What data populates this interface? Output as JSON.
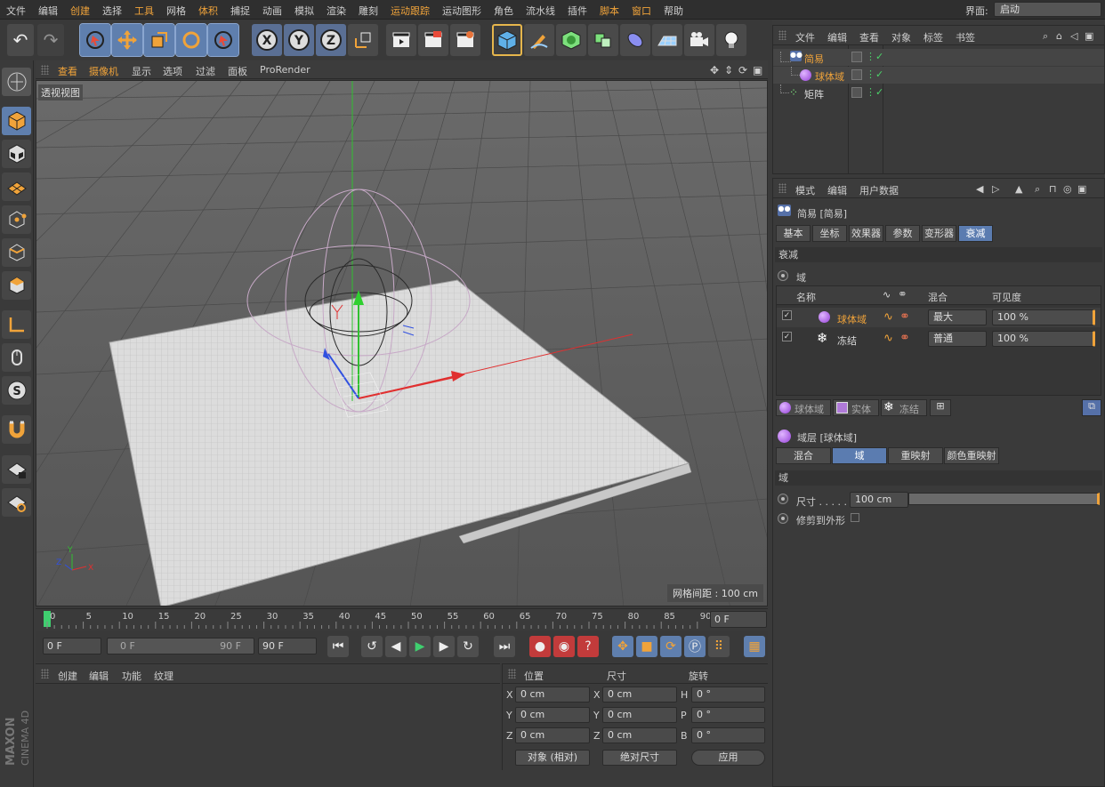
{
  "menubar": {
    "items": [
      "文件",
      "编辑",
      "创建",
      "选择",
      "工具",
      "网格",
      "体积",
      "捕捉",
      "动画",
      "模拟",
      "渲染",
      "雕刻",
      "运动跟踪",
      "运动图形",
      "角色",
      "流水线",
      "插件",
      "脚本",
      "窗口",
      "帮助"
    ],
    "highlighted": [
      "创建",
      "工具",
      "体积",
      "运动跟踪",
      "脚本",
      "窗口"
    ],
    "layout_label": "界面:",
    "layout_value": "启动"
  },
  "viewport": {
    "menus": [
      "查看",
      "摄像机",
      "显示",
      "选项",
      "过滤",
      "面板",
      "ProRender"
    ],
    "view_name": "透视视图",
    "grid_spacing": "网格间距 : 100 cm",
    "axis_labels": {
      "x": "X",
      "y": "Y",
      "z": "Z"
    }
  },
  "timeline": {
    "ticks": [
      "0",
      "5",
      "10",
      "15",
      "20",
      "25",
      "30",
      "35",
      "40",
      "45",
      "50",
      "55",
      "60",
      "65",
      "70",
      "75",
      "80",
      "85",
      "90"
    ],
    "current_frame_field": "0 F"
  },
  "transport": {
    "start": "0 F",
    "range_start": "0 F",
    "range_end": "90 F",
    "end": "90 F"
  },
  "material_panel": {
    "menus": [
      "创建",
      "编辑",
      "功能",
      "纹理"
    ]
  },
  "coord_panel": {
    "headers": [
      "位置",
      "尺寸",
      "旋转"
    ],
    "rows": [
      {
        "a": "X",
        "av": "0 cm",
        "b": "X",
        "bv": "0 cm",
        "c": "H",
        "cv": "0 °"
      },
      {
        "a": "Y",
        "av": "0 cm",
        "b": "Y",
        "bv": "0 cm",
        "c": "P",
        "cv": "0 °"
      },
      {
        "a": "Z",
        "av": "0 cm",
        "b": "Z",
        "bv": "0 cm",
        "c": "B",
        "cv": "0 °"
      }
    ],
    "mode_select": "对象 (相对)",
    "size_select": "绝对尺寸",
    "apply": "应用"
  },
  "object_manager": {
    "menus": [
      "文件",
      "编辑",
      "查看",
      "对象",
      "标签",
      "书签"
    ],
    "objects": [
      {
        "name": "简易",
        "indent": 0
      },
      {
        "name": "球体域",
        "indent": 1
      },
      {
        "name": "矩阵",
        "indent": 0
      }
    ]
  },
  "attributes": {
    "menus": [
      "模式",
      "编辑",
      "用户数据"
    ],
    "object_title": "简易 [简易]",
    "tabs": [
      "基本",
      "坐标",
      "效果器",
      "参数",
      "变形器",
      "衰减"
    ],
    "active_tab": "衰减",
    "section_falloff": "衰减",
    "field_radio_label": "域",
    "field_list_headers": {
      "name": "名称",
      "blend": "混合",
      "visibility": "可见度"
    },
    "field_list": [
      {
        "name": "球体域",
        "blend": "最大",
        "visibility": "100 %"
      },
      {
        "name": "冻结",
        "blend": "普通",
        "visibility": "100 %"
      }
    ],
    "add_buttons": [
      "球体域",
      "实体",
      "冻结"
    ],
    "layer_title": "域层 [球体域]",
    "layer_tabs": [
      "混合",
      "域",
      "重映射",
      "颜色重映射"
    ],
    "active_layer_tab": "域",
    "section_field": "域",
    "size_label": "尺寸 . . . . . .",
    "size_value": "100 cm",
    "clip_label": "修剪到外形"
  },
  "branding": {
    "maxon": "MAXON",
    "product": "CINEMA 4D"
  },
  "colors": {
    "accent": "#f0a33a",
    "selection": "#5f7fae",
    "x_axis": "#e03030",
    "y_axis": "#30c030",
    "z_axis": "#3050e0"
  }
}
